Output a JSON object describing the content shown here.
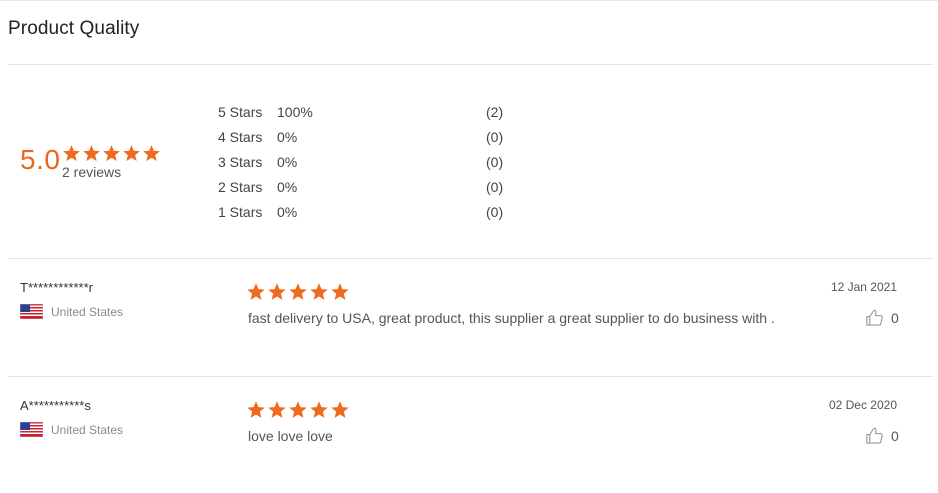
{
  "section": {
    "title": "Product Quality"
  },
  "summary": {
    "score": "5.0",
    "stars": 5,
    "reviews_label": "2 reviews",
    "star_color": "#ee6a1e"
  },
  "distribution": [
    {
      "label": "5 Stars",
      "percent": "100%",
      "count": "(2)"
    },
    {
      "label": "4 Stars",
      "percent": "0%",
      "count": "(0)"
    },
    {
      "label": "3 Stars",
      "percent": "0%",
      "count": "(0)"
    },
    {
      "label": "2 Stars",
      "percent": "0%",
      "count": "(0)"
    },
    {
      "label": "1 Stars",
      "percent": "0%",
      "count": "(0)"
    }
  ],
  "reviews": [
    {
      "reviewer": "T************r",
      "country": "United States",
      "flag": "us-flag-icon",
      "stars": 5,
      "text": "fast delivery to USA, great product, this supplier a great supplier to do business with .",
      "date": "12 Jan 2021",
      "helpful_count": "0"
    },
    {
      "reviewer": "A***********s",
      "country": "United States",
      "flag": "us-flag-icon",
      "stars": 5,
      "text": "love love love",
      "date": "02 Dec 2020",
      "helpful_count": "0"
    }
  ],
  "icons": {
    "star": "star-icon",
    "helpful": "thumbs-up-icon"
  },
  "colors": {
    "accent": "#e9661f",
    "star": "#ee6a1e",
    "divider": "#e3e3e3"
  }
}
